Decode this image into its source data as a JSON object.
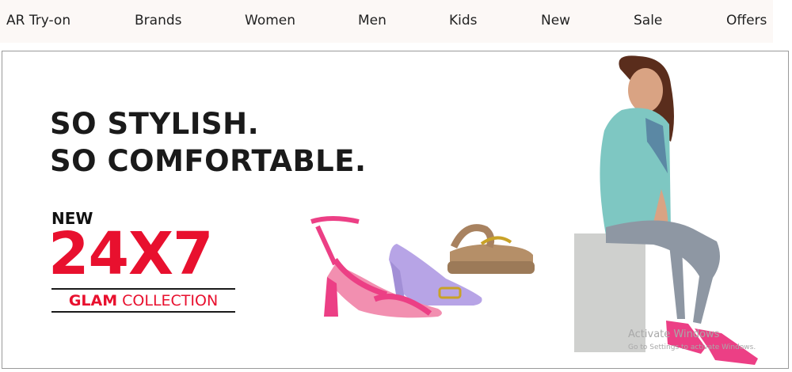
{
  "nav": {
    "items": [
      {
        "label": "AR Try-on"
      },
      {
        "label": "Brands"
      },
      {
        "label": "Women"
      },
      {
        "label": "Men"
      },
      {
        "label": "Kids"
      },
      {
        "label": "New"
      },
      {
        "label": "Sale"
      },
      {
        "label": "Offers"
      }
    ]
  },
  "banner": {
    "headline_line1": "SO STYLISH.",
    "headline_line2": "SO COMFORTABLE.",
    "new_label": "NEW",
    "collection_code": "24X7",
    "collection_glam": "GLAM",
    "collection_word": "COLLECTION",
    "accent_color": "#e8102e"
  },
  "watermark": {
    "title": "Activate Windows",
    "subtitle": "Go to Settings to activate Windows."
  }
}
